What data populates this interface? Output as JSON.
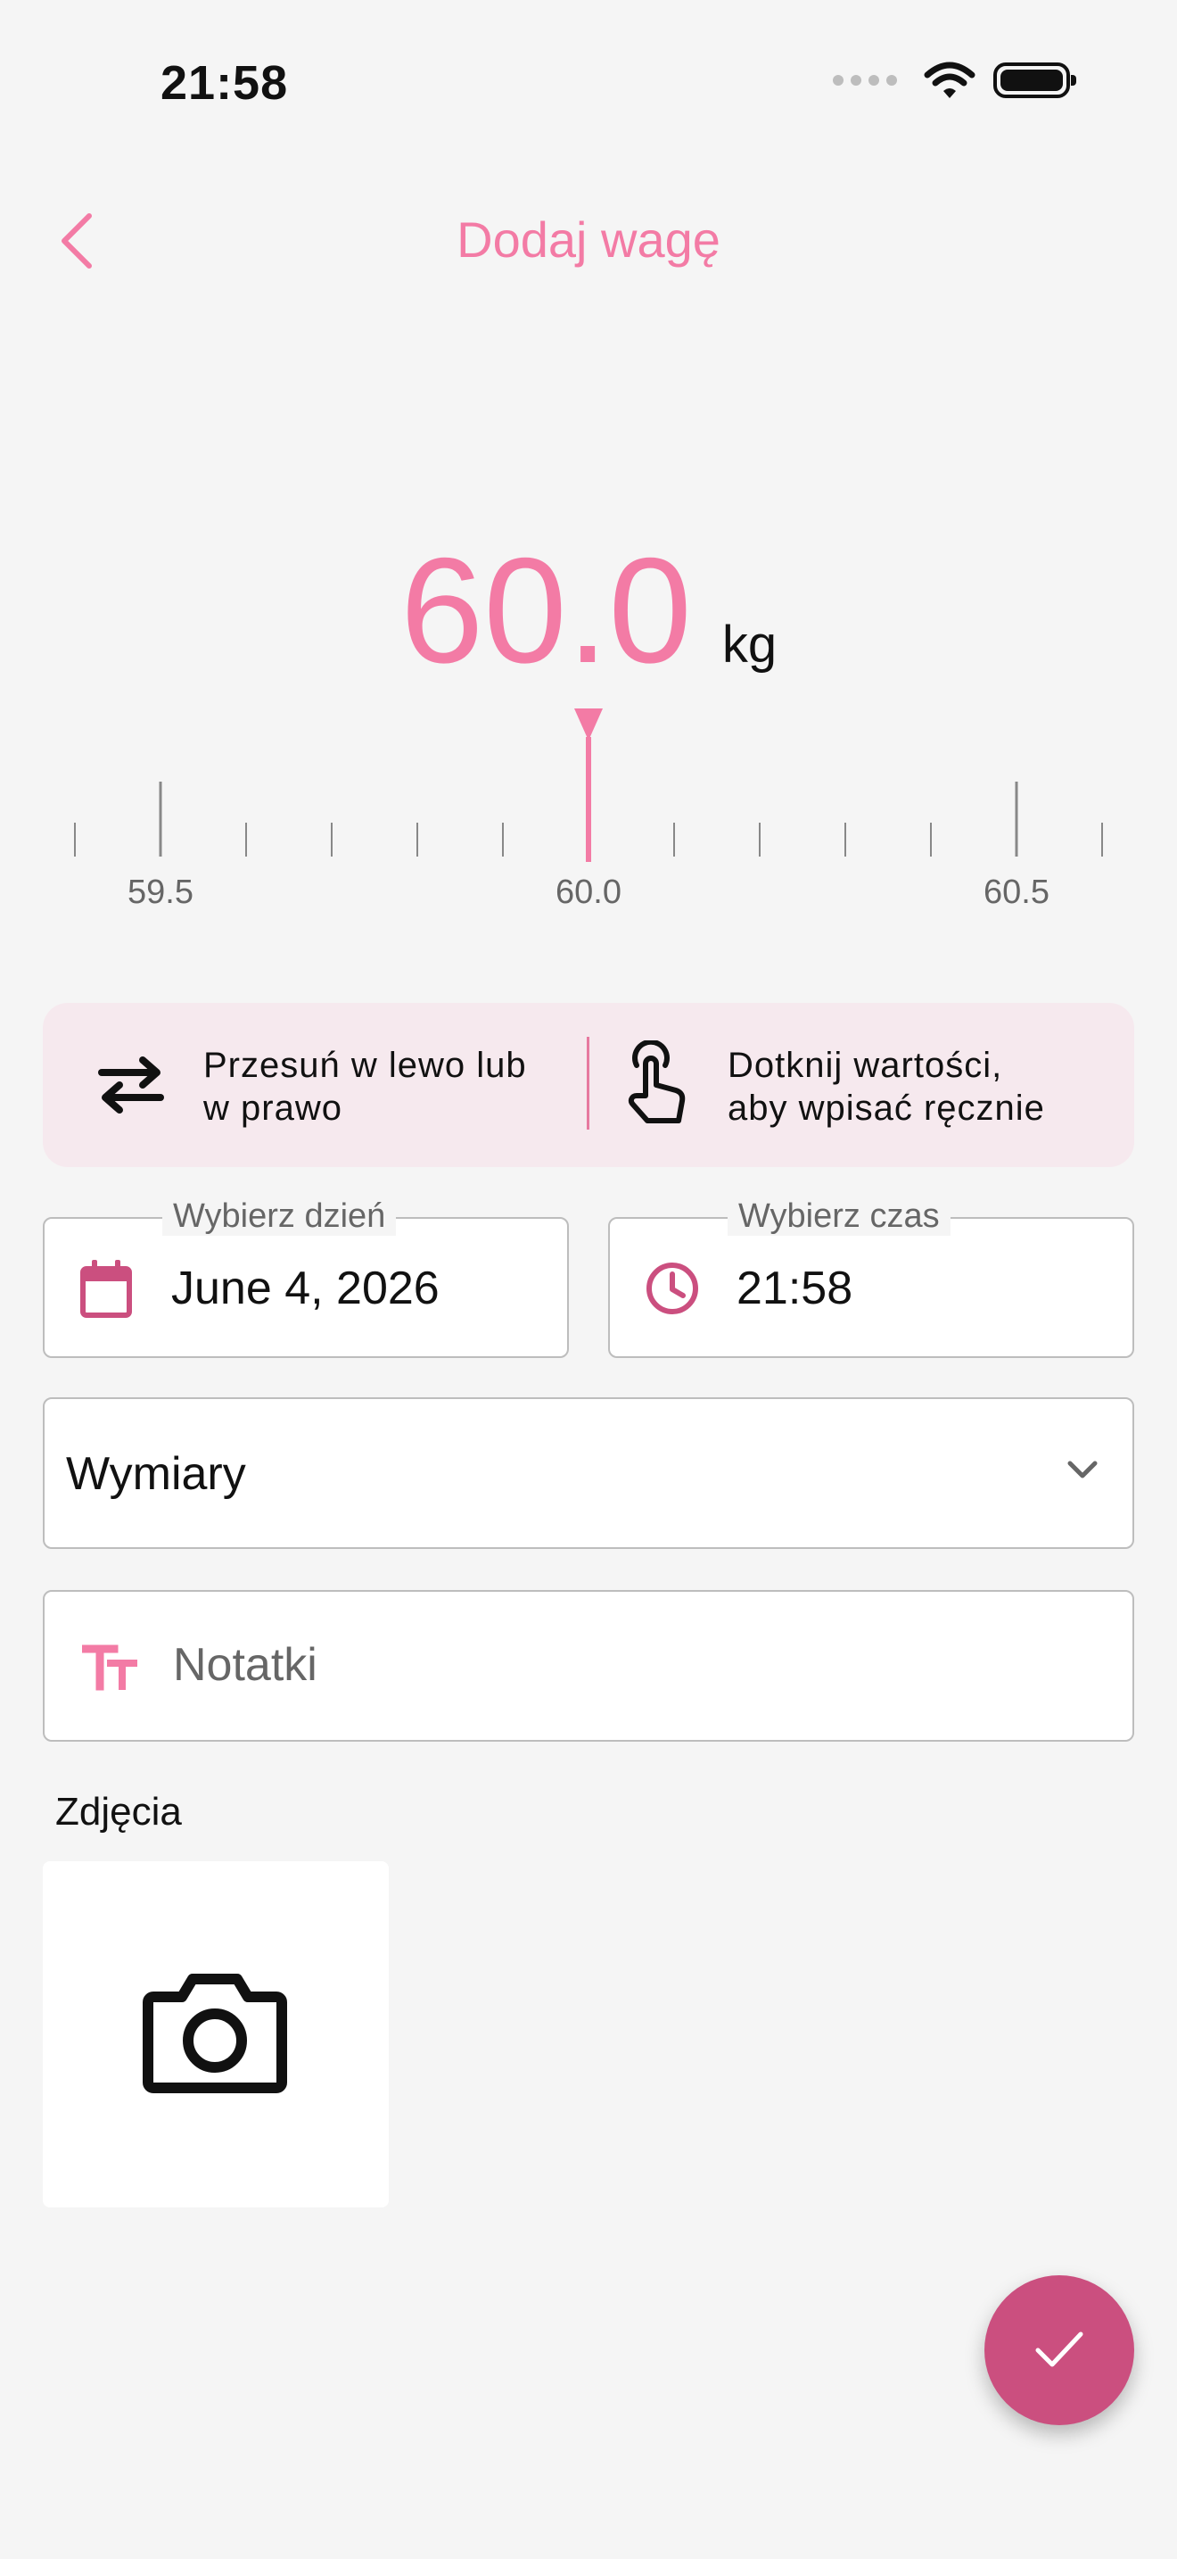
{
  "status_bar": {
    "time": "21:58",
    "icons": [
      "signal-dots-icon",
      "wifi-icon",
      "battery-icon"
    ]
  },
  "header": {
    "title": "Dodaj wagę",
    "back_icon": "chevron-left-icon"
  },
  "weight": {
    "value": "60.0",
    "unit": "kg",
    "ruler": {
      "labels": [
        "59.5",
        "60.0",
        "60.5"
      ],
      "min": 59.5,
      "max": 60.5,
      "step": 0.1,
      "selected": 60.0
    }
  },
  "hints": {
    "swipe": {
      "icon": "swap-arrows-icon",
      "line1": "Przesuń w lewo lub",
      "line2": "w prawo"
    },
    "tap": {
      "icon": "touch-finger-icon",
      "line1": "Dotknij wartości,",
      "line2": "aby wpisać ręcznie"
    }
  },
  "date_field": {
    "label": "Wybierz dzień",
    "value": "June 4, 2026",
    "icon": "calendar-icon"
  },
  "time_field": {
    "label": "Wybierz czas",
    "value": "21:58",
    "icon": "clock-icon"
  },
  "measurements": {
    "label": "Wymiary",
    "icon": "chevron-down-icon"
  },
  "notes": {
    "placeholder": "Notatki",
    "icon": "text-size-icon"
  },
  "photos": {
    "title": "Zdjęcia",
    "icon": "camera-icon"
  },
  "fab": {
    "icon": "check-icon"
  },
  "colors": {
    "accent": "#f37ba5",
    "accent_dark": "#cb4f7f",
    "hint_bg": "#f6e9ee",
    "background": "#f5f5f5"
  }
}
